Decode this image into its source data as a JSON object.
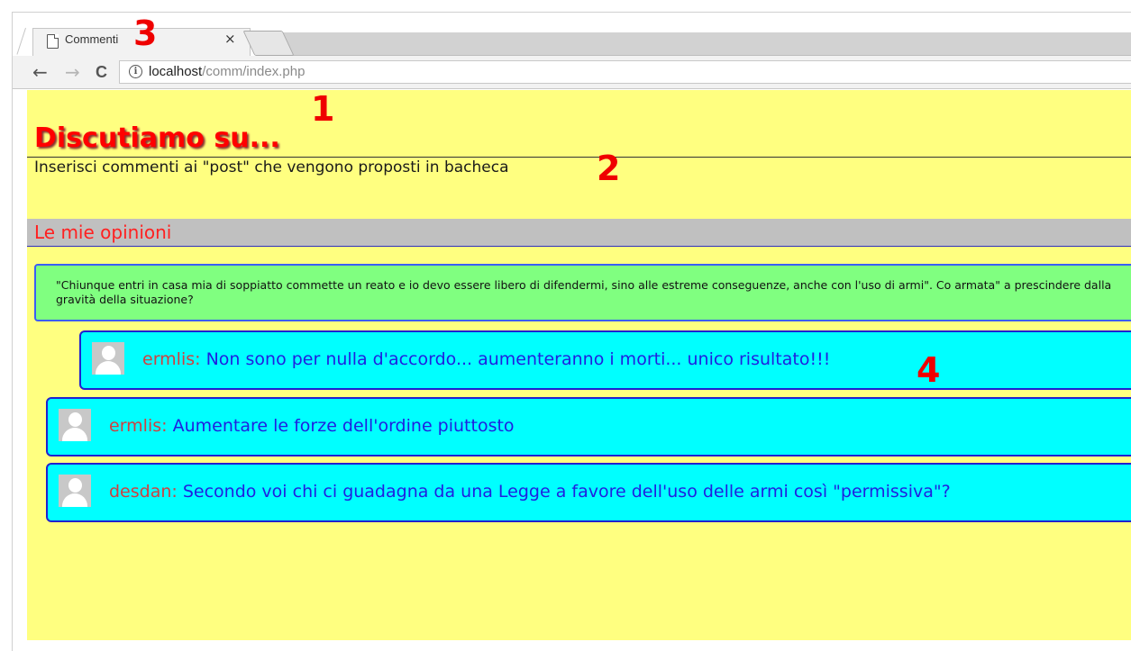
{
  "browser": {
    "tab_title": "Commenti",
    "tab_close": "×",
    "url_host": "localhost",
    "url_path": "/comm/index.php",
    "back_glyph": "←",
    "forward_glyph": "→",
    "reload_glyph": "C",
    "info_glyph": "i"
  },
  "page": {
    "site_title": "Discutiamo su...",
    "subtitle": "Inserisci commenti ai \"post\" che vengono proposti in bacheca",
    "section_title": "Le mie opinioni",
    "post_text": "\"Chiunque entri in casa mia di soppiatto commette un reato e io devo essere libero di difendermi, sino alle estreme conseguenze, anche con l'uso di armi\". Co armata\" a prescindere dalla gravità della situazione?",
    "comments": [
      {
        "author": "ermlis:",
        "text": "Non sono per nulla d'accordo... aumenteranno i morti... unico risultato!!!"
      },
      {
        "author": "ermlis:",
        "text": "Aumentare le forze dell'ordine piuttosto"
      },
      {
        "author": "desdan:",
        "text": "Secondo voi chi ci guadagna da una Legge a favore dell'uso delle armi così \"permissiva\"?"
      }
    ]
  },
  "annotations": {
    "n1": "1",
    "n2": "2",
    "n3": "3",
    "n4": "4"
  },
  "colors": {
    "page_background": "#ffff80",
    "title": "#ff0000",
    "post_background": "#80ff80",
    "comment_background": "#00ffff",
    "comment_author": "#d04040",
    "comment_text": "#2020e0",
    "annotation": "#ef0000"
  }
}
